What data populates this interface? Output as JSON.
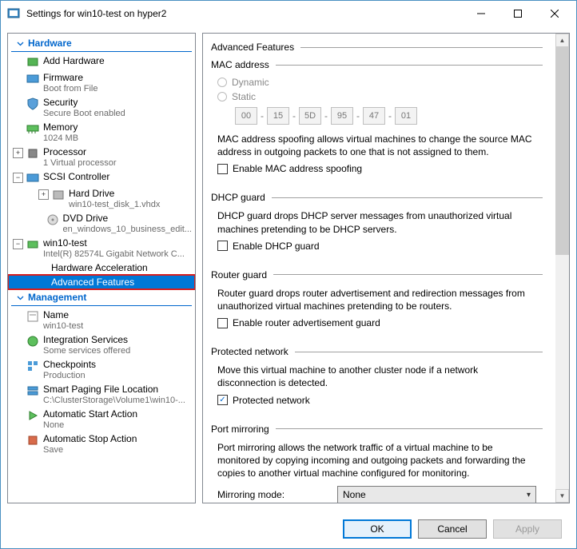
{
  "titlebar": {
    "title": "Settings for win10-test on hyper2"
  },
  "sections": {
    "hardware": "Hardware",
    "management": "Management"
  },
  "tree": {
    "addHardware": "Add Hardware",
    "firmware": {
      "label": "Firmware",
      "sub": "Boot from File"
    },
    "security": {
      "label": "Security",
      "sub": "Secure Boot enabled"
    },
    "memory": {
      "label": "Memory",
      "sub": "1024 MB"
    },
    "processor": {
      "label": "Processor",
      "sub": "1 Virtual processor"
    },
    "scsi": {
      "label": "SCSI Controller",
      "hd": {
        "label": "Hard Drive",
        "sub": "win10-test_disk_1.vhdx"
      },
      "dvd": {
        "label": "DVD Drive",
        "sub": "en_windows_10_business_edit..."
      }
    },
    "nic": {
      "label": "win10-test",
      "sub": "Intel(R) 82574L Gigabit Network C...",
      "hwaccel": "Hardware Acceleration",
      "advanced": "Advanced Features"
    },
    "name": {
      "label": "Name",
      "sub": "win10-test"
    },
    "integration": {
      "label": "Integration Services",
      "sub": "Some services offered"
    },
    "checkpoints": {
      "label": "Checkpoints",
      "sub": "Production"
    },
    "smartPaging": {
      "label": "Smart Paging File Location",
      "sub": "C:\\ClusterStorage\\Volume1\\win10-..."
    },
    "autoStart": {
      "label": "Automatic Start Action",
      "sub": "None"
    },
    "autoStop": {
      "label": "Automatic Stop Action",
      "sub": "Save"
    }
  },
  "main": {
    "title": "Advanced Features",
    "mac": {
      "title": "MAC address",
      "dynamic": "Dynamic",
      "static": "Static",
      "bytes": [
        "00",
        "15",
        "5D",
        "95",
        "47",
        "01"
      ],
      "desc": "MAC address spoofing allows virtual machines to change the source MAC address in outgoing packets to one that is not assigned to them.",
      "check": "Enable MAC address spoofing"
    },
    "dhcp": {
      "title": "DHCP guard",
      "desc": "DHCP guard drops DHCP server messages from unauthorized virtual machines pretending to be DHCP servers.",
      "check": "Enable DHCP guard"
    },
    "router": {
      "title": "Router guard",
      "desc": "Router guard drops router advertisement and redirection messages from unauthorized virtual machines pretending to be routers.",
      "check": "Enable router advertisement guard"
    },
    "protected": {
      "title": "Protected network",
      "desc": "Move this virtual machine to another cluster node if a network disconnection is detected.",
      "check": "Protected network"
    },
    "portMirror": {
      "title": "Port mirroring",
      "desc": "Port mirroring allows the network traffic of a virtual machine to be monitored by copying incoming and outgoing packets and forwarding the copies to another virtual machine configured for monitoring.",
      "modeLabel": "Mirroring mode:",
      "mode": "None"
    }
  },
  "footer": {
    "ok": "OK",
    "cancel": "Cancel",
    "apply": "Apply"
  }
}
